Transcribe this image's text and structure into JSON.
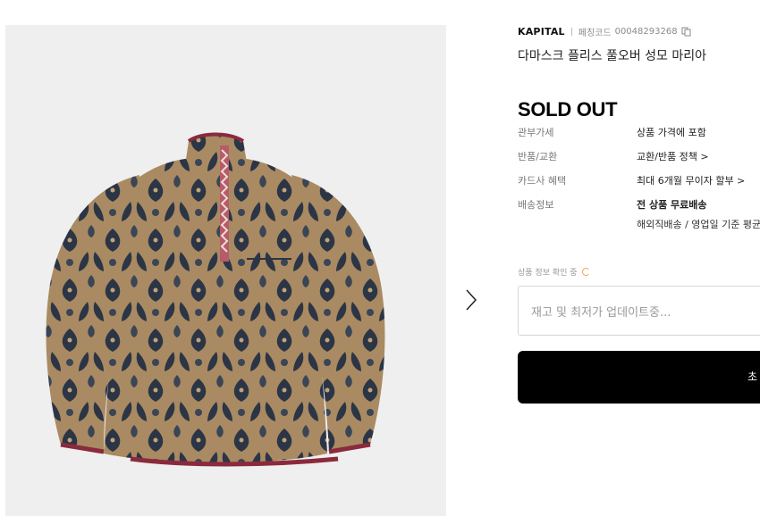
{
  "product": {
    "brand": "KAPITAL",
    "code_label": "페칭코드",
    "code": "00048293268",
    "title": "다마스크 플리스 풀오버 성모 마리아",
    "status": "SOLD OUT",
    "image": "fleece-pullover-photo"
  },
  "info_rows": [
    {
      "label": "관부가세",
      "value": "상품 가격에 포함"
    },
    {
      "label": "반품/교환",
      "value": "교환/반품 정책 >"
    },
    {
      "label": "카드사 혜택",
      "value": "최대 6개월 무이자 할부 >"
    },
    {
      "label": "배송정보",
      "value": "전 상품 무료배송",
      "sub_value": "해외직배송 / 영업일 기준 평균"
    }
  ],
  "checking": {
    "label": "상품 정보 확인 중"
  },
  "update_box": {
    "text": "재고 및 최저가 업데이트중..."
  },
  "buy_button": {
    "label": "초"
  },
  "colors": {
    "accent": "#000000",
    "spinner": "#f0a64a",
    "trim": "#8a2a3c"
  },
  "icons": {
    "next": "chevron-right-icon",
    "copy": "copy-icon",
    "loading": "spinner-icon"
  }
}
